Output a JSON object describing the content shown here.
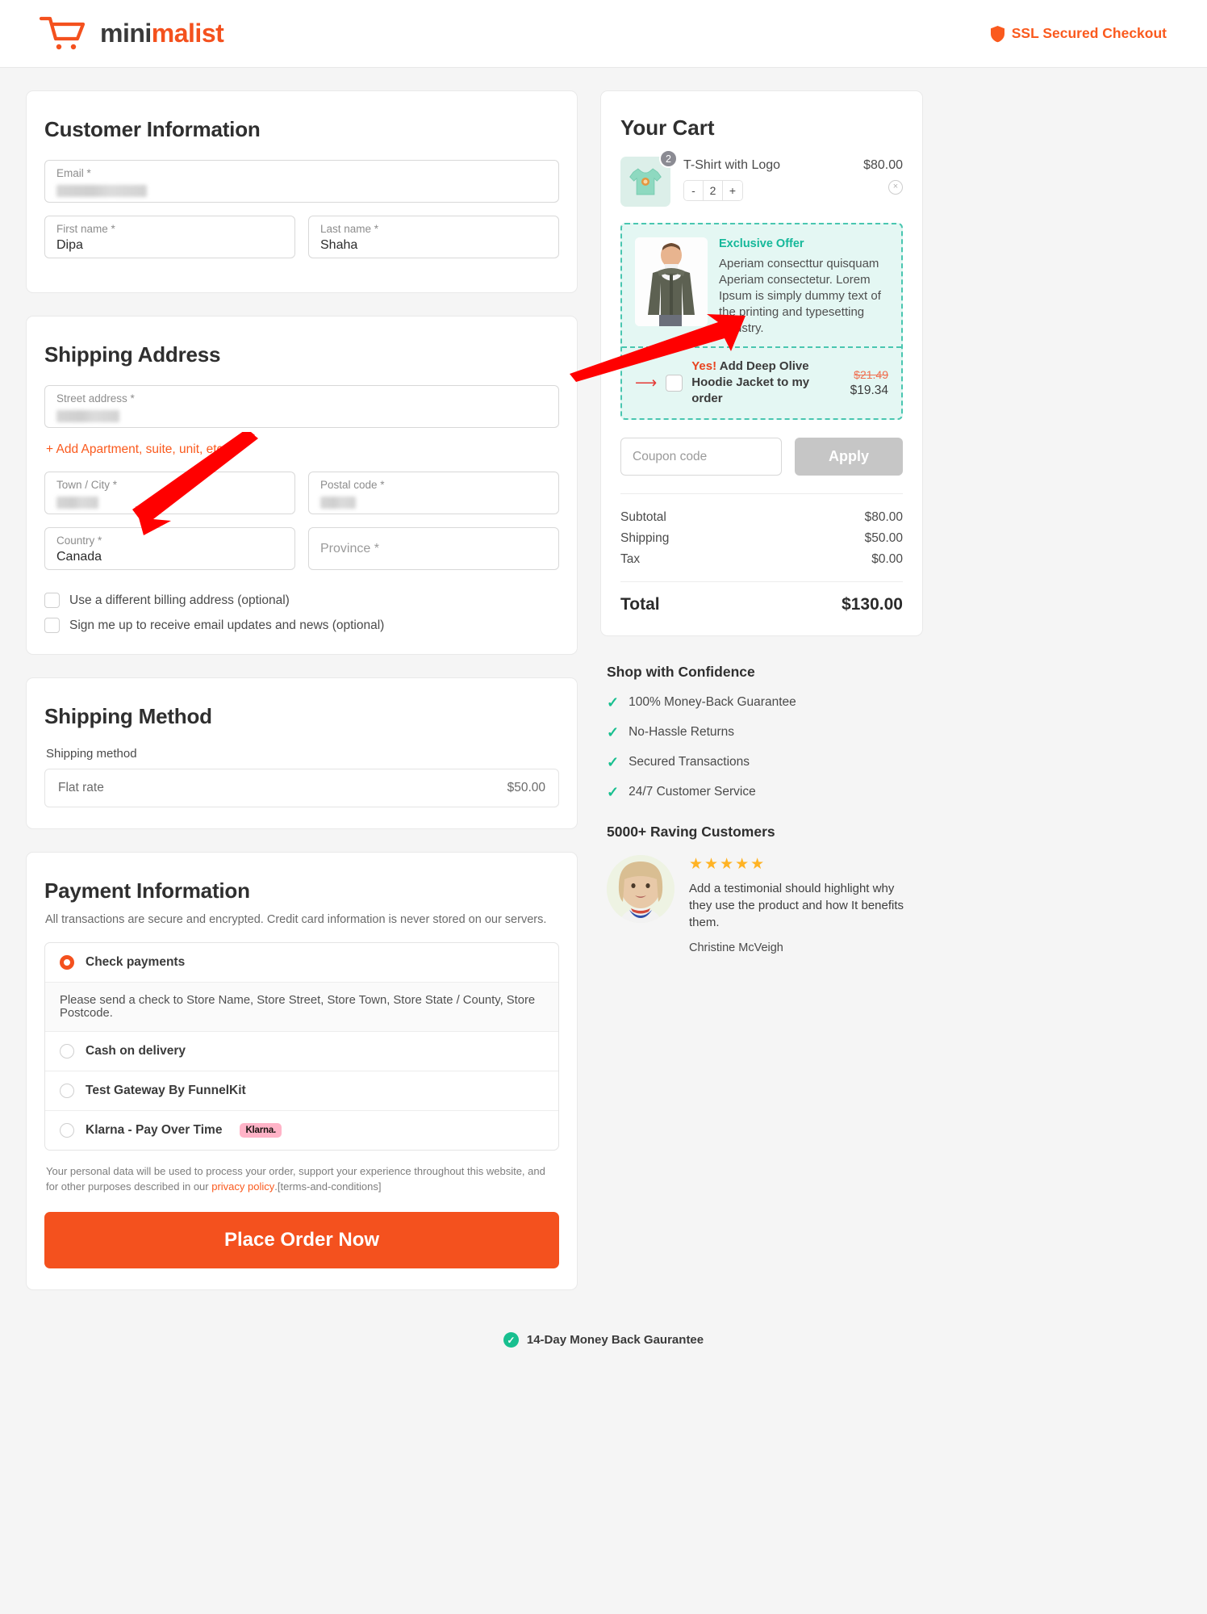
{
  "header": {
    "brand_part1": "mini",
    "brand_part2": "malist",
    "ssl_text": "SSL Secured Checkout"
  },
  "customer": {
    "title": "Customer Information",
    "email_label": "Email *",
    "email_value": "",
    "first_name_label": "First name *",
    "first_name_value": "Dipa",
    "last_name_label": "Last name *",
    "last_name_value": "Shaha"
  },
  "shipping_address": {
    "title": "Shipping Address",
    "street_label": "Street address *",
    "street_value": "",
    "add_apartment": "+ Add Apartment, suite, unit, etc.",
    "city_label": "Town / City *",
    "city_value": "",
    "postal_label": "Postal code *",
    "postal_value": "",
    "country_label": "Country *",
    "country_value": "Canada",
    "province_label": "Province *",
    "province_value": "",
    "billing_checkbox": "Use a different billing address (optional)",
    "newsletter_checkbox": "Sign me up to receive email updates and news (optional)"
  },
  "shipping_method": {
    "title": "Shipping Method",
    "field_label": "Shipping method",
    "option_name": "Flat rate",
    "option_price": "$50.00"
  },
  "payment": {
    "title": "Payment Information",
    "subtitle": "All transactions are secure and encrypted. Credit card information is never stored on our servers.",
    "options": [
      {
        "label": "Check payments",
        "selected": true,
        "badge": ""
      },
      {
        "label": "Cash on delivery",
        "selected": false,
        "badge": ""
      },
      {
        "label": "Test Gateway By FunnelKit",
        "selected": false,
        "badge": ""
      },
      {
        "label": "Klarna - Pay Over Time",
        "selected": false,
        "badge": "Klarna."
      }
    ],
    "check_note": "Please send a check to Store Name, Store Street, Store Town, Store State / County, Store Postcode.",
    "legal_pre": "Your personal data will be used to process your order, support your experience throughout this website, and for other purposes described in our ",
    "legal_link": "privacy policy",
    "legal_post": ".[terms-and-conditions]",
    "place_order": "Place Order Now"
  },
  "cart": {
    "title": "Your Cart",
    "item_name": "T-Shirt with Logo",
    "item_price": "$80.00",
    "item_qty": "2",
    "qty_badge": "2",
    "minus": "-",
    "plus": "+",
    "remove": "×"
  },
  "bump": {
    "eyebrow": "Exclusive Offer",
    "description": "Aperiam consecttur quisquam Aperiam consectetur. Lorem Ipsum is simply dummy text of the printing and typesetting industry.",
    "yes": "Yes!",
    "offer_text": "Add Deep Olive Hoodie Jacket to my order",
    "old_price": "$21.49",
    "new_price": "$19.34"
  },
  "coupon": {
    "placeholder": "Coupon code",
    "value": "",
    "apply_label": "Apply"
  },
  "totals": {
    "rows": [
      {
        "label": "Subtotal",
        "value": "$80.00"
      },
      {
        "label": "Shipping",
        "value": "$50.00"
      },
      {
        "label": "Tax",
        "value": "$0.00"
      }
    ],
    "total_label": "Total",
    "total_value": "$130.00"
  },
  "trust": {
    "title": "Shop with Confidence",
    "items": [
      "100% Money-Back Guarantee",
      "No-Hassle Returns",
      "Secured Transactions",
      "24/7 Customer Service"
    ]
  },
  "testimonial": {
    "heading": "5000+ Raving Customers",
    "stars": "★★★★★",
    "text": "Add a testimonial should highlight why they use the product and how It benefits them.",
    "name": "Christine McVeigh"
  },
  "footer": {
    "guarantee": "14-Day Money Back Gaurantee"
  },
  "colors": {
    "accent": "#f4511e",
    "bump_border": "#49c6b0",
    "bump_bg": "#e4f7f3",
    "tick_green": "#18bf8f",
    "klarna_pink": "#ffb3c7"
  }
}
